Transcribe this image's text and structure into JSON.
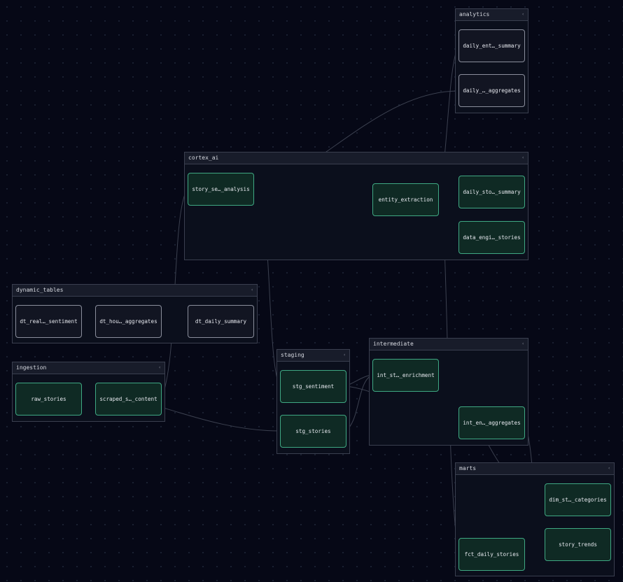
{
  "colors": {
    "background": "#060816",
    "managed_node_border": "#3fa883",
    "managed_node_fill": "#0f2a24",
    "dynamic_node_border": "#8a8e9c",
    "dynamic_node_fill": "#121522",
    "edge": "#3c4150"
  },
  "groups": {
    "analytics": {
      "title": "analytics",
      "toggle": "‹"
    },
    "cortex_ai": {
      "title": "cortex_ai",
      "toggle": "‹"
    },
    "dynamic_tables": {
      "title": "dynamic_tables",
      "toggle": "‹"
    },
    "ingestion": {
      "title": "ingestion",
      "toggle": "‹"
    },
    "staging": {
      "title": "staging",
      "toggle": "‹"
    },
    "intermediate": {
      "title": "intermediate",
      "toggle": "‹"
    },
    "marts": {
      "title": "marts",
      "toggle": "‹"
    }
  },
  "nodes": {
    "daily_entity_summary": {
      "label": "daily_ent…_summary",
      "kind": "dynamic"
    },
    "daily_aggregates": {
      "label": "daily_…_aggregates",
      "kind": "dynamic"
    },
    "story_sentiment_analysis": {
      "label": "story_se…_analysis",
      "kind": "managed"
    },
    "entity_extraction": {
      "label": "entity_extraction",
      "kind": "managed"
    },
    "daily_story_summary": {
      "label": "daily_sto…_summary",
      "kind": "managed"
    },
    "data_engineering_stories": {
      "label": "data_engi…_stories",
      "kind": "managed"
    },
    "dt_realtime_sentiment": {
      "label": "dt_real…_sentiment",
      "kind": "dynamic"
    },
    "dt_hourly_aggregates": {
      "label": "dt_hou…_aggregates",
      "kind": "dynamic"
    },
    "dt_daily_summary": {
      "label": "dt_daily_summary",
      "kind": "dynamic"
    },
    "raw_stories": {
      "label": "raw_stories",
      "kind": "managed"
    },
    "scraped_story_content": {
      "label": "scraped_s…_content",
      "kind": "managed"
    },
    "stg_sentiment": {
      "label": "stg_sentiment",
      "kind": "managed"
    },
    "stg_stories": {
      "label": "stg_stories",
      "kind": "managed"
    },
    "int_story_enrichment": {
      "label": "int_st…_enrichment",
      "kind": "managed"
    },
    "int_entity_aggregates": {
      "label": "int_en…_aggregates",
      "kind": "managed"
    },
    "dim_story_categories": {
      "label": "dim_st…_categories",
      "kind": "managed"
    },
    "story_trends": {
      "label": "story_trends",
      "kind": "managed"
    },
    "fct_daily_stories": {
      "label": "fct_daily_stories",
      "kind": "managed"
    }
  }
}
